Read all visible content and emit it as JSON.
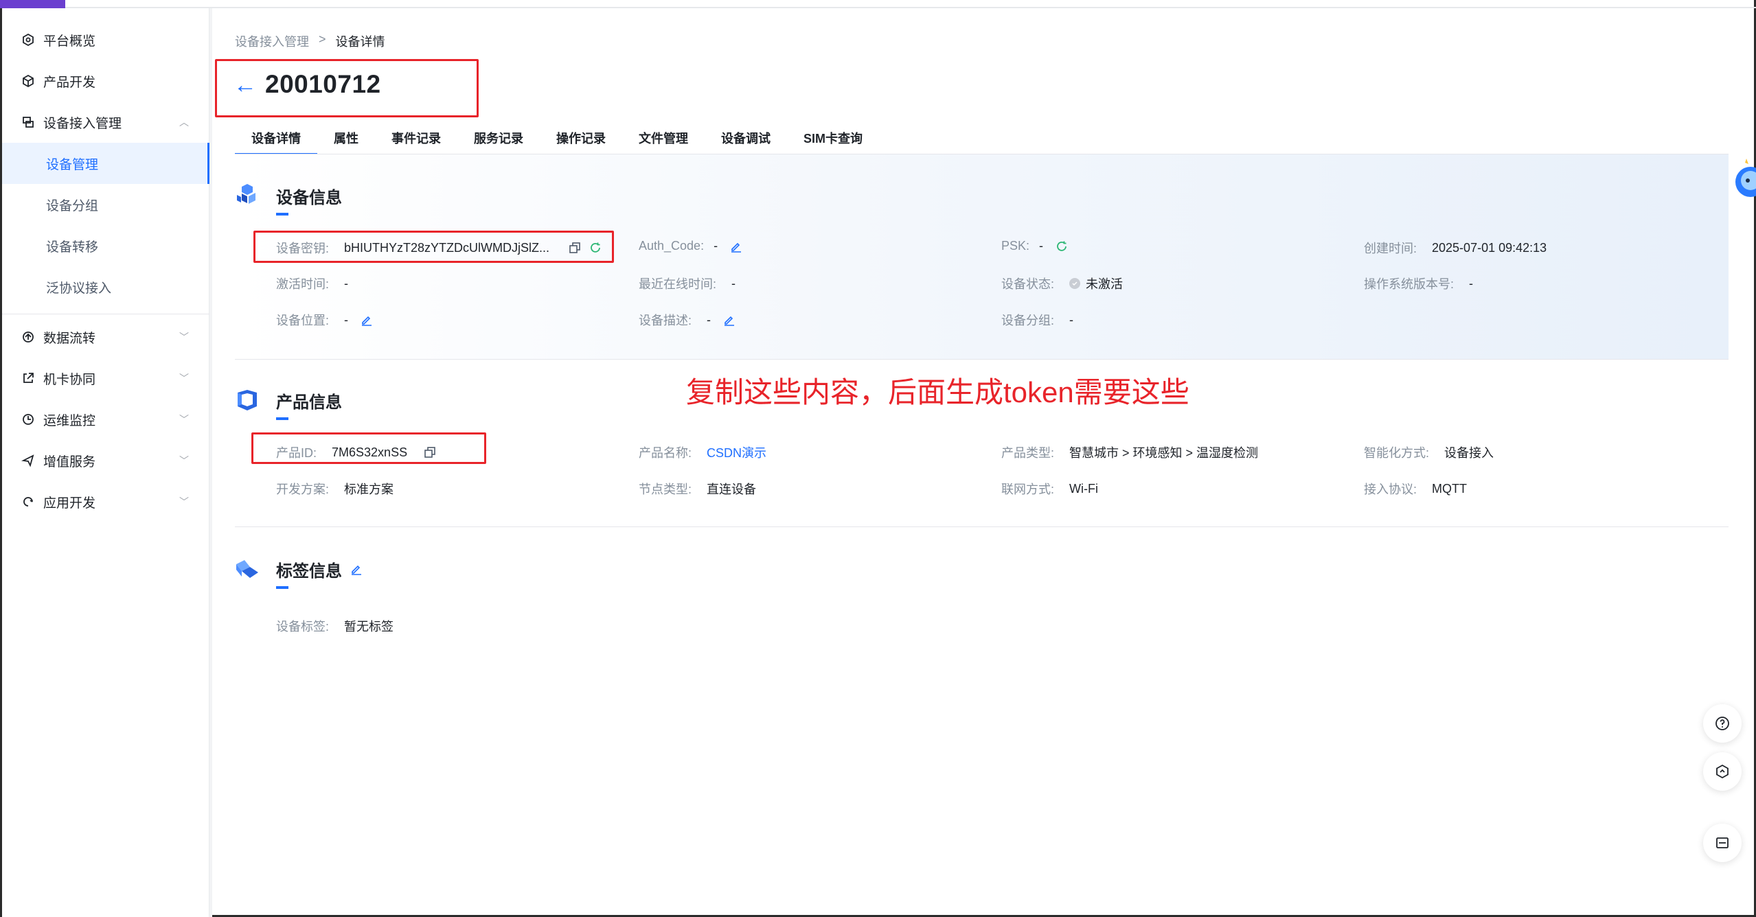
{
  "sidebar": {
    "items": [
      {
        "label": "平台概览",
        "icon": "overview-icon"
      },
      {
        "label": "产品开发",
        "icon": "product-icon"
      },
      {
        "label": "设备接入管理",
        "icon": "device-access-icon",
        "expanded": true
      },
      {
        "label": "数据流转",
        "icon": "data-flow-icon"
      },
      {
        "label": "机卡协同",
        "icon": "card-sync-icon"
      },
      {
        "label": "运维监控",
        "icon": "monitor-icon"
      },
      {
        "label": "增值服务",
        "icon": "value-service-icon"
      },
      {
        "label": "应用开发",
        "icon": "app-dev-icon"
      }
    ],
    "sub_items": [
      {
        "label": "设备管理",
        "active": true
      },
      {
        "label": "设备分组"
      },
      {
        "label": "设备转移"
      },
      {
        "label": "泛协议接入"
      }
    ]
  },
  "breadcrumb": {
    "parent": "设备接入管理",
    "separator": ">",
    "current": "设备详情"
  },
  "page": {
    "title": "20010712"
  },
  "tabs": [
    "设备详情",
    "属性",
    "事件记录",
    "服务记录",
    "操作记录",
    "文件管理",
    "设备调试",
    "SIM卡查询"
  ],
  "device_info": {
    "title": "设备信息",
    "fields": {
      "secret": {
        "k": "设备密钥:",
        "v": "bHIUTHYzT28zYTZDcUlWMDJjSlZ..."
      },
      "auth_code": {
        "k": "Auth_Code:",
        "v": "-"
      },
      "psk": {
        "k": "PSK:",
        "v": "-"
      },
      "created": {
        "k": "创建时间:",
        "v": "2025-07-01 09:42:13"
      },
      "activated": {
        "k": "激活时间:",
        "v": "-"
      },
      "last_online": {
        "k": "最近在线时间:",
        "v": "-"
      },
      "status": {
        "k": "设备状态:",
        "v": "未激活"
      },
      "os_version": {
        "k": "操作系统版本号:",
        "v": "-"
      },
      "location": {
        "k": "设备位置:",
        "v": "-"
      },
      "desc": {
        "k": "设备描述:",
        "v": "-"
      },
      "group": {
        "k": "设备分组:",
        "v": "-"
      }
    }
  },
  "annotation": "复制这些内容，后面生成token需要这些",
  "product_info": {
    "title": "产品信息",
    "fields": {
      "id": {
        "k": "产品ID:",
        "v": "7M6S32xnSS"
      },
      "name": {
        "k": "产品名称:",
        "v": "CSDN演示"
      },
      "type": {
        "k": "产品类型:",
        "v": "智慧城市 > 环境感知 > 温湿度检测"
      },
      "intel": {
        "k": "智能化方式:",
        "v": "设备接入"
      },
      "scheme": {
        "k": "开发方案:",
        "v": "标准方案"
      },
      "node": {
        "k": "节点类型:",
        "v": "直连设备"
      },
      "network": {
        "k": "联网方式:",
        "v": "Wi-Fi"
      },
      "protocol": {
        "k": "接入协议:",
        "v": "MQTT"
      }
    }
  },
  "tag_info": {
    "title": "标签信息",
    "fields": {
      "tags": {
        "k": "设备标签:",
        "v": "暂无标签"
      }
    }
  },
  "colors": {
    "accent": "#1f6fff",
    "annotation_red": "#e8242a",
    "success_green": "#2bb673"
  }
}
